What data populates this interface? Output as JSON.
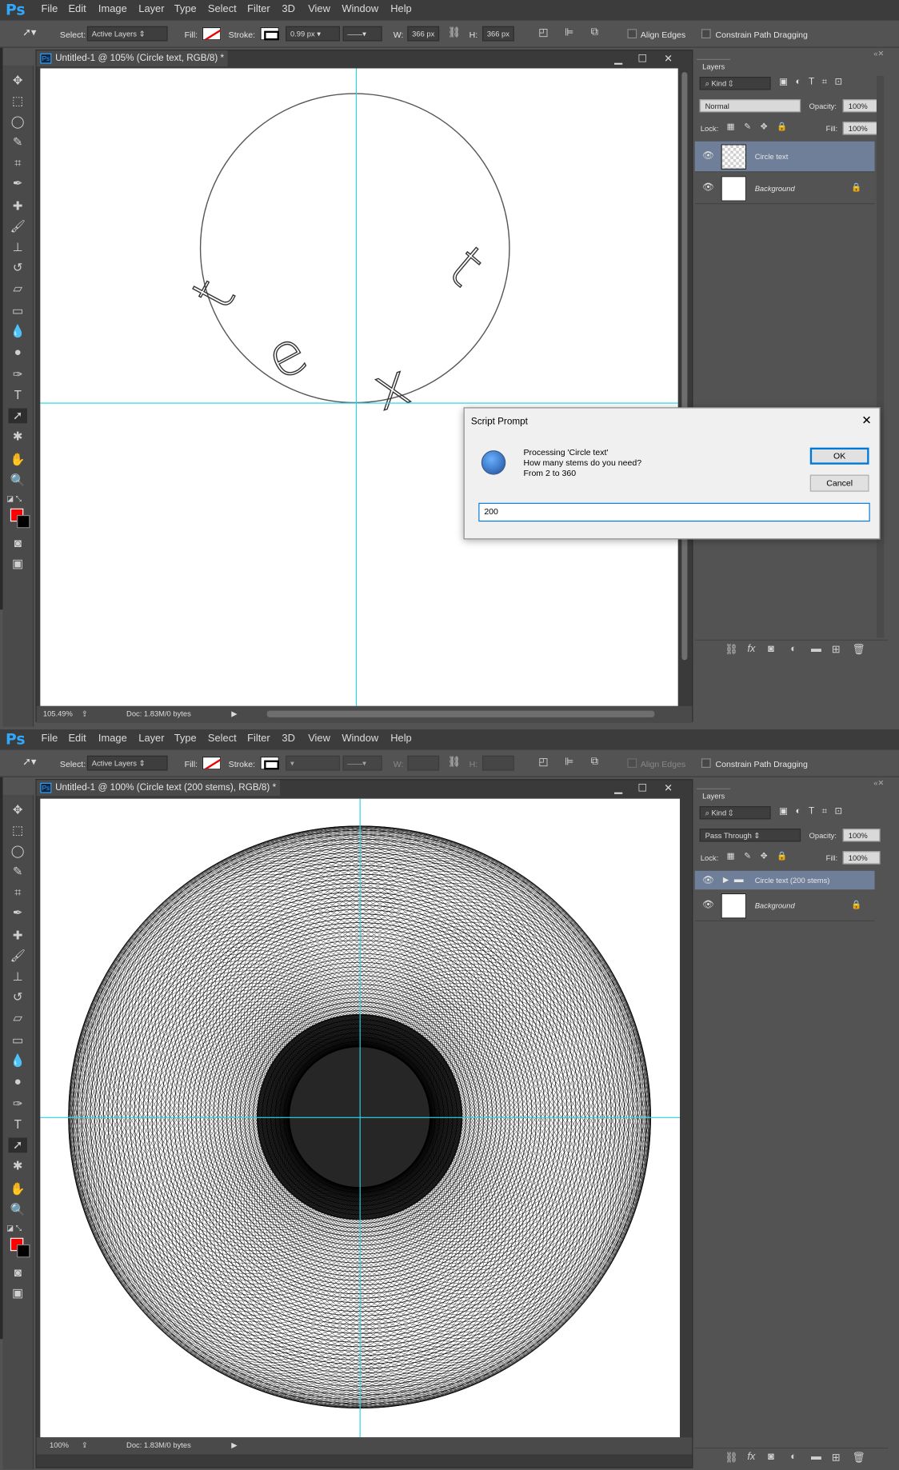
{
  "menu": [
    "File",
    "Edit",
    "Image",
    "Layer",
    "Type",
    "Select",
    "Filter",
    "3D",
    "View",
    "Window",
    "Help"
  ],
  "app_logo": "Ps",
  "scene1": {
    "options": {
      "select_label": "Select:",
      "select_value": "Active Layers",
      "fill_label": "Fill:",
      "stroke_label": "Stroke:",
      "stroke_width": "0.99 px",
      "w_label": "W:",
      "w_value": "366 px",
      "h_label": "H:",
      "h_value": "366 px",
      "align_edges": "Align Edges",
      "constrain": "Constrain Path Dragging"
    },
    "doc_title": "Untitled-1 @ 105% (Circle text, RGB/8) *",
    "status_zoom": "105.49%",
    "status_doc": "Doc: 1.83M/0 bytes",
    "layers": {
      "tab": "Layers",
      "kind": "Kind",
      "blend": "Normal",
      "opacity_label": "Opacity:",
      "opacity": "100%",
      "lock_label": "Lock:",
      "fill_label": "Fill:",
      "fill": "100%",
      "items": [
        {
          "name": "Circle text",
          "selected": true
        },
        {
          "name": "Background",
          "selected": false
        }
      ]
    },
    "circle_text": [
      "t",
      "e",
      "x",
      "t"
    ],
    "dialog": {
      "title": "Script Prompt",
      "line1": "Processing 'Circle text'",
      "line2": "How many stems do you need?",
      "line3": "From 2 to 360",
      "ok": "OK",
      "cancel": "Cancel",
      "value": "200"
    }
  },
  "scene2": {
    "options": {
      "select_label": "Select:",
      "select_value": "Active Layers",
      "fill_label": "Fill:",
      "stroke_label": "Stroke:",
      "w_label": "W:",
      "h_label": "H:",
      "align_edges": "Align Edges",
      "constrain": "Constrain Path Dragging"
    },
    "doc_title": "Untitled-1 @ 100% (Circle text (200 stems), RGB/8) *",
    "status_zoom": "100%",
    "status_doc": "Doc: 1.83M/0 bytes",
    "stems": 200,
    "layers": {
      "tab": "Layers",
      "kind": "Kind",
      "blend": "Pass Through",
      "opacity_label": "Opacity:",
      "opacity": "100%",
      "lock_label": "Lock:",
      "fill_label": "Fill:",
      "fill": "100%",
      "items": [
        {
          "name": "Circle text (200 stems)",
          "selected": true
        },
        {
          "name": "Background",
          "selected": false
        }
      ]
    }
  },
  "colors": {
    "foreground": "#ff0000",
    "background": "#000000",
    "guide": "#29d3e6",
    "accent": "#31a8ff"
  }
}
